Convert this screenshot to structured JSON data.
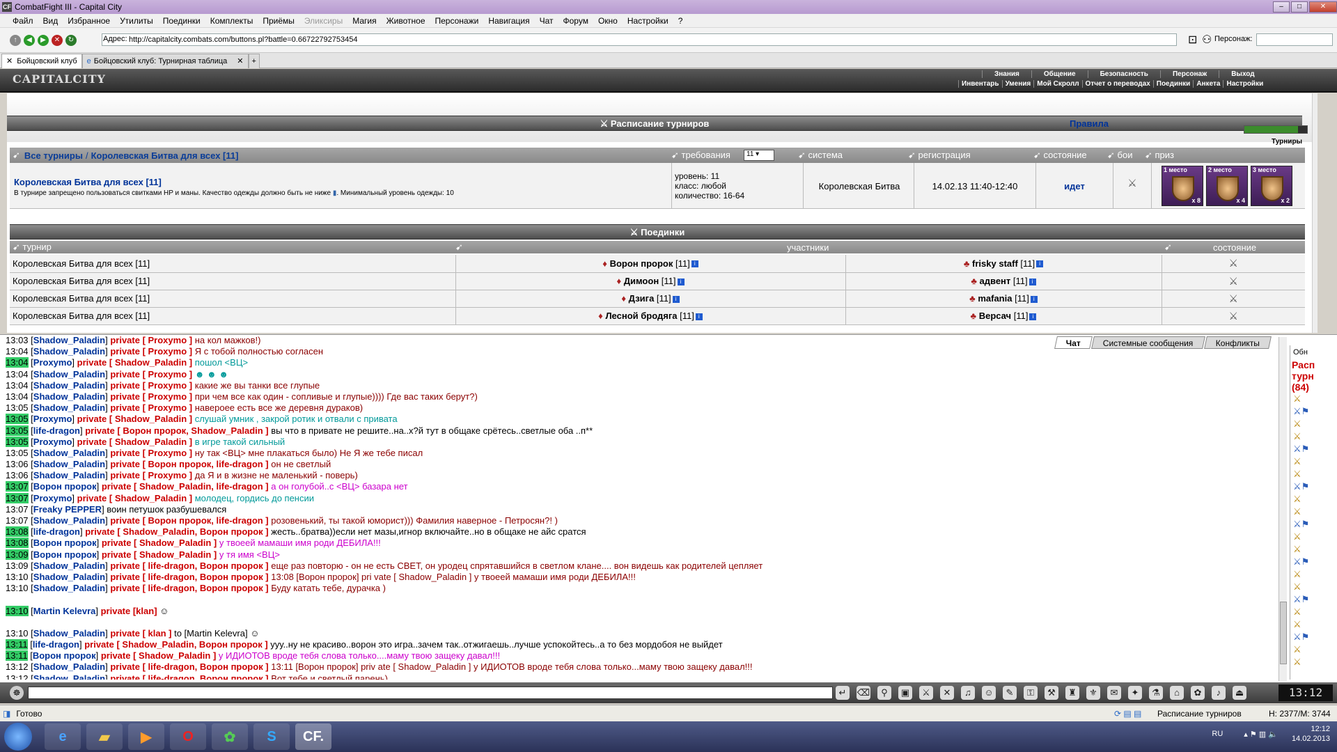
{
  "window": {
    "title": "CombatFight III - Capital City",
    "app_short": "CF"
  },
  "menu": [
    "Файл",
    "Вид",
    "Избранное",
    "Утилиты",
    "Поединки",
    "Комплекты",
    "Приёмы",
    "Эликсиры",
    "Магия",
    "Животное",
    "Персонажи",
    "Навигация",
    "Чат",
    "Форум",
    "Окно",
    "Настройки",
    "?"
  ],
  "address": {
    "label": "Адрес:",
    "url": "http://capitalcity.combats.com/buttons.pl?battle=0.6672279275345​4",
    "persona_label": "Персонаж:"
  },
  "tabs": [
    {
      "label": "Бойцовский клуб"
    },
    {
      "label": "Бойцовский клуб: Турнирная таблица"
    }
  ],
  "game": {
    "logo": "CAPITALCITY",
    "nav_top": [
      "Знания",
      "Общение",
      "Безопасность",
      "Персонаж",
      "Выход"
    ],
    "nav_bottom": [
      "Инвентарь",
      "Умения",
      "Мой Скролл",
      "Отчет о переводах",
      "Поединки",
      "Анкета",
      "Настройки"
    ]
  },
  "schedule": {
    "banner": "Расписание турниров",
    "rules_link": "Правила",
    "tournaments_link": "Турниры",
    "breadcrumb_all": "Все турниры",
    "breadcrumb_sep": "/",
    "breadcrumb_current": "Королевская Битва для всех [11]",
    "headers": {
      "requirements": "требования",
      "level_select": "11",
      "system": "система",
      "registration": "регистрация",
      "state": "состояние",
      "fights": "бои",
      "prize": "приз"
    },
    "row": {
      "name": "Королевская Битва для всех [11]",
      "note": "В турнире запрещено пользоваться свитками HP и маны. Качество одежды должно быть не ниже",
      "note2": "Минимальный уровень одежды: 10",
      "req_level": "уровень: 11",
      "req_class": "класс: любой",
      "req_count": "количество: 16-64",
      "system": "Королевская Битва",
      "registration": "14.02.13 11:40-12:40",
      "state": "идет",
      "prizes": [
        {
          "place": "1 место",
          "count": "x 8"
        },
        {
          "place": "2 место",
          "count": "x 4"
        },
        {
          "place": "3 место",
          "count": "x 2"
        }
      ]
    }
  },
  "fights": {
    "banner": "Поединки",
    "headers": {
      "tournament": "турнир",
      "participants": "участники",
      "state": "состояние"
    },
    "rows": [
      {
        "tournament": "Королевская Битва для всех [11]",
        "p1": "Ворон пророк",
        "p1lvl": "[11]",
        "p2": "frisky staff",
        "p2lvl": "[11]"
      },
      {
        "tournament": "Королевская Битва для всех [11]",
        "p1": "Димоон",
        "p1lvl": "[11]",
        "p2": "адвент",
        "p2lvl": "[11]"
      },
      {
        "tournament": "Королевская Битва для всех [11]",
        "p1": "Дзига",
        "p1lvl": "[11]",
        "p2": "mafania",
        "p2lvl": "[11]"
      },
      {
        "tournament": "Королевская Битва для всех [11]",
        "p1": "Лесной бродяга",
        "p1lvl": "[11]",
        "p2": "Версач",
        "p2lvl": "[11]"
      }
    ]
  },
  "chat": {
    "tabs": [
      "Чат",
      "Системные сообщения",
      "Конфликты"
    ],
    "right_panel": {
      "refresh": "Обн",
      "title1": "Расп",
      "title2": "турн",
      "count": "(84)"
    },
    "lines": [
      {
        "t": "13:03",
        "g": false,
        "n": "Shadow_Paladin",
        "p": "private [ Proxymo ]",
        "m": "на кол мажков!)",
        "c": "m1"
      },
      {
        "t": "13:04",
        "g": false,
        "n": "Shadow_Paladin",
        "p": "private [ Proxymo ]",
        "m": "Я с тобой полностью согласен",
        "c": "m1"
      },
      {
        "t": "13:04",
        "g": true,
        "n": "Proxymo",
        "p": "private [ Shadow_Paladin ]",
        "m": "пошол <ВЦ>",
        "c": "m2"
      },
      {
        "t": "13:04",
        "g": false,
        "n": "Shadow_Paladin",
        "p": "private [ Proxymo ]",
        "m": "☻ ☻ ☻",
        "c": "m2"
      },
      {
        "t": "13:04",
        "g": false,
        "n": "Shadow_Paladin",
        "p": "private [ Proxymo ]",
        "m": "какие же вы танки все глупые",
        "c": "m1"
      },
      {
        "t": "13:04",
        "g": false,
        "n": "Shadow_Paladin",
        "p": "private [ Proxymo ]",
        "m": "при чем все как один - сопливые и глупые)))) Где вас таких берут?)",
        "c": "m1"
      },
      {
        "t": "13:05",
        "g": false,
        "n": "Shadow_Paladin",
        "p": "private [ Proxymo ]",
        "m": "навероее есть все же деревня дураков)",
        "c": "m1"
      },
      {
        "t": "13:05",
        "g": true,
        "n": "Proxymo",
        "p": "private [ Shadow_Paladin ]",
        "m": "слушай умник , закрой ротик и отвали с привата",
        "c": "m2"
      },
      {
        "t": "13:05",
        "g": true,
        "n": "life-dragon",
        "p": "private [ Ворон пророк, Shadow_Paladin ]",
        "m": "вы что в привате не решите..на..х?й тут в общаке срётесь..светлые оба ..п**",
        "c": "m0"
      },
      {
        "t": "13:05",
        "g": true,
        "n": "Proxymo",
        "p": "private [ Shadow_Paladin ]",
        "m": "в игре такой сильный",
        "c": "m2"
      },
      {
        "t": "13:05",
        "g": false,
        "n": "Shadow_Paladin",
        "p": "private [ Proxymo ]",
        "m": "ну так <ВЦ> мне плакаться было) Не Я же тебе писал",
        "c": "m1"
      },
      {
        "t": "13:06",
        "g": false,
        "n": "Shadow_Paladin",
        "p": "private [ Ворон пророк, life-dragon ]",
        "m": "он не светлый",
        "c": "m1"
      },
      {
        "t": "13:06",
        "g": false,
        "n": "Shadow_Paladin",
        "p": "private [ Proxymo ]",
        "m": "да Я и в жизне не маленький - поверь)",
        "c": "m1"
      },
      {
        "t": "13:07",
        "g": true,
        "n": "Ворон пророк",
        "p": "private [ Shadow_Paladin, life-dragon ]",
        "m": "а он голубой..с <ВЦ> базара нет",
        "c": "m3"
      },
      {
        "t": "13:07",
        "g": true,
        "n": "Proxymo",
        "p": "private [ Shadow_Paladin ]",
        "m": "молодец, гордись до пенсии",
        "c": "m2"
      },
      {
        "t": "13:07",
        "g": false,
        "n": "Freaky PEPPER",
        "p": "",
        "m": "воин петушок разбушевался",
        "c": "m0"
      },
      {
        "t": "13:07",
        "g": false,
        "n": "Shadow_Paladin",
        "p": "private [ Ворон пророк, life-dragon ]",
        "m": "розовенький, ты такой юморист))) Фамилия наверное - Петросян?! )",
        "c": "m1"
      },
      {
        "t": "13:08",
        "g": true,
        "n": "life-dragon",
        "p": "private [ Shadow_Paladin, Ворон пророк ]",
        "m": "жесть..братва))если нет мазы,игнор включайте..но в общаке не айс сратся",
        "c": "m0"
      },
      {
        "t": "13:08",
        "g": true,
        "n": "Ворон пророк",
        "p": "private [ Shadow_Paladin ]",
        "m": "у твоеей мамаши имя роди ДЕБИЛА!!!",
        "c": "m3"
      },
      {
        "t": "13:09",
        "g": true,
        "n": "Ворон пророк",
        "p": "private [ Shadow_Paladin ]",
        "m": "у тя имя <ВЦ>",
        "c": "m3"
      },
      {
        "t": "13:09",
        "g": false,
        "n": "Shadow_Paladin",
        "p": "private [ life-dragon, Ворон пророк ]",
        "m": "еще раз повторю - он не есть СВЕТ, он уродец спрятавшийся в светлом клане.... вон видешь как родителей цепляет",
        "c": "m1"
      },
      {
        "t": "13:10",
        "g": false,
        "n": "Shadow_Paladin",
        "p": "private [ life-dragon, Ворон пророк ]",
        "m": "13:08 [Ворон пророк] pri vate [ Shadow_Paladin ] у твоеей мамаши имя роди ДЕБИЛА!!!",
        "c": "m1"
      },
      {
        "t": "13:10",
        "g": false,
        "n": "Shadow_Paladin",
        "p": "private [ life-dragon, Ворон пророк ]",
        "m": "Буду катать тебе, дурачка )",
        "c": "m1"
      },
      {
        "t": "",
        "g": false,
        "n": "",
        "p": "",
        "m": "",
        "c": "m0"
      },
      {
        "t": "13:10",
        "g": true,
        "n": "Martin Kelevra",
        "p": "private [klan]",
        "m": "☺",
        "c": "m0"
      },
      {
        "t": "",
        "g": false,
        "n": "",
        "p": "",
        "m": "",
        "c": "m0"
      },
      {
        "t": "13:10",
        "g": false,
        "n": "Shadow_Paladin",
        "p": "private [ klan ]",
        "m": "to [Martin Kelevra] ☺",
        "c": "m0"
      },
      {
        "t": "13:11",
        "g": true,
        "n": "life-dragon",
        "p": "private [ Shadow_Paladin, Ворон пророк ]",
        "m": "ууу..ну не красиво..ворон это игра..зачем так..отжигаешь..лучше успокойтесь..а то без мордобоя не выйдет",
        "c": "m0"
      },
      {
        "t": "13:11",
        "g": true,
        "n": "Ворон пророк",
        "p": "private [ Shadow_Paladin ]",
        "m": "у ИДИОТОВ вроде тебя слова только....маму твою защеку давал!!!",
        "c": "m3"
      },
      {
        "t": "13:12",
        "g": false,
        "n": "Shadow_Paladin",
        "p": "private [ life-dragon, Ворон пророк ]",
        "m": "13:11 [Ворон пророк] priv ate [ Shadow_Paladin ] у ИДИОТОВ вроде тебя слова только...маму твою защеку давал!!!",
        "c": "m1"
      },
      {
        "t": "13:12",
        "g": false,
        "n": "Shadow_Paladin",
        "p": "private [ life-dragon, Ворон пророк ]",
        "m": "Вот тебе и светлый парень)",
        "c": "m1"
      }
    ]
  },
  "toolbar": {
    "clock": "13:12"
  },
  "status": {
    "left": "Готово",
    "page": "Расписание турниров",
    "memory": "H: 2377/M: 3744"
  },
  "taskbar": {
    "lang": "RU",
    "time": "12:12",
    "date": "14.02.2013",
    "cf_label": "CF."
  }
}
